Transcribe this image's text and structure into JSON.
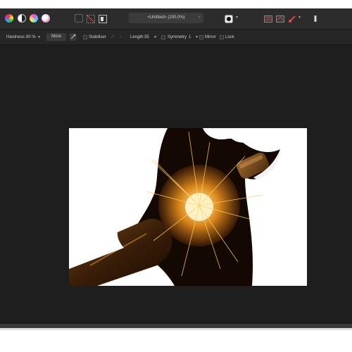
{
  "document": {
    "title": "<Untitled> (200.0%)"
  },
  "context_toolbar": {
    "hardness_label": "Hardness:",
    "hardness_value": "80 %",
    "more_label": "More",
    "stabiliser_label": "Stabiliser",
    "length_label": "Length:",
    "length_value": "35",
    "symmetry_label": "Symmetry",
    "symmetry_value": "1",
    "mirror_label": "Mirror",
    "lock_label": "Lock"
  },
  "colors": {
    "toolbar_bg": "#2c2c2c",
    "canvas_bg": "#1e1e1e",
    "artboard_bg": "#ffffff",
    "accent_red": "#d64545"
  },
  "icons": [
    "persona-photo-icon",
    "contrast-icon",
    "color-wheel-icon",
    "white-balance-icon",
    "marquee-selection-icon",
    "no-selection-icon",
    "mask-icon",
    "quick-mask-icon",
    "assistant-icon",
    "snapping-icon",
    "brush-color-icon"
  ]
}
